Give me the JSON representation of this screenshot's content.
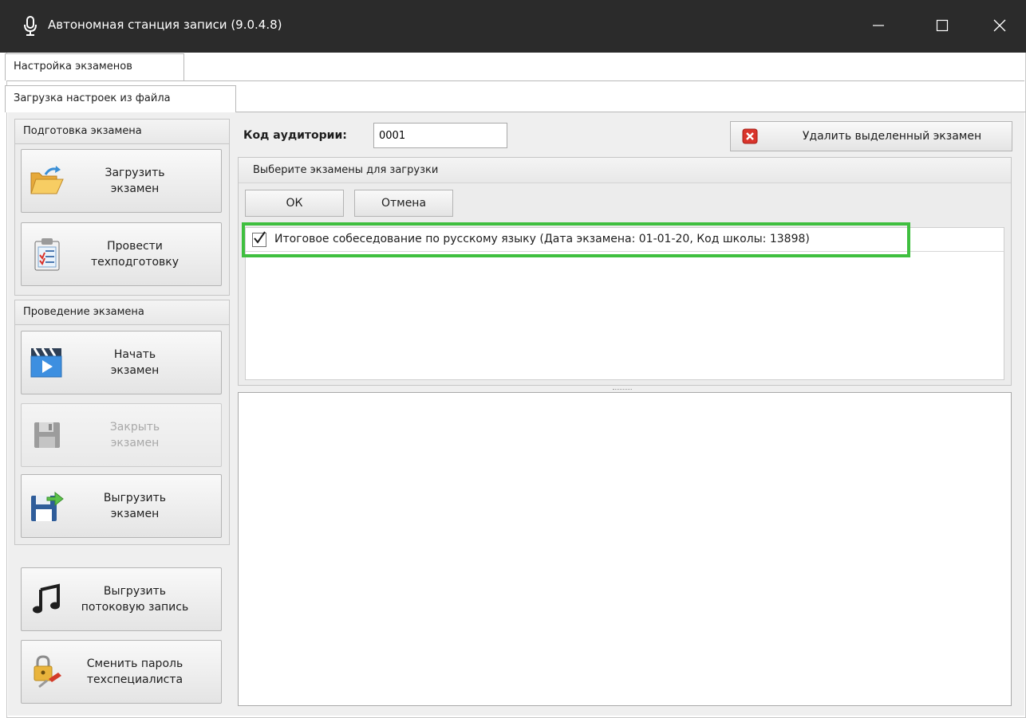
{
  "window": {
    "title": "Автономная станция записи (9.0.4.8)",
    "controls": [
      "minimize-icon",
      "maximize-icon",
      "close-icon"
    ]
  },
  "tabs": {
    "main": "Настройка экзаменов",
    "sub": "Загрузка настроек из файла"
  },
  "sidebar": {
    "prep_group": {
      "header": "Подготовка экзамена",
      "load_line1": "Загрузить",
      "load_line2": "экзамен",
      "tech_line1": "Провести",
      "tech_line2": "техподготовку"
    },
    "exam_group": {
      "header": "Проведение экзамена",
      "start_line1": "Начать",
      "start_line2": "экзамен",
      "close_line1": "Закрыть",
      "close_line2": "экзамен",
      "export_line1": "Выгрузить",
      "export_line2": "экзамен"
    },
    "stream_line1": "Выгрузить",
    "stream_line2": "потоковую запись",
    "password_line1": "Сменить пароль",
    "password_line2": "техспециалиста"
  },
  "toolbar": {
    "room_code_label": "Код аудитории:",
    "room_code_value": "0001",
    "delete_label": "Удалить выделенный экзамен"
  },
  "select_panel": {
    "header": "Выберите экзамены для загрузки",
    "ok_label": "ОК",
    "cancel_label": "Отмена",
    "items": [
      {
        "checked": true,
        "label": "Итоговое собеседование по русскому языку (Дата экзамена: 01-01-20, Код школы: 13898)"
      }
    ]
  },
  "colors": {
    "titlebar": "#2b2b2b",
    "highlight": "#3fbf3f",
    "panel": "#ececec"
  }
}
